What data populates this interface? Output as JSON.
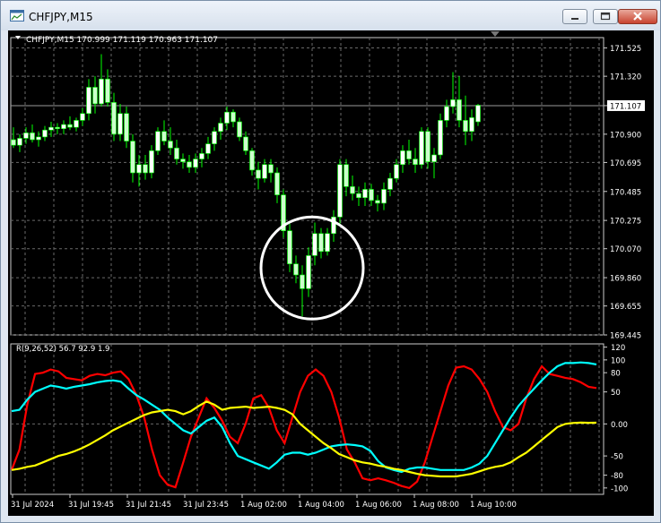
{
  "window": {
    "title": "CHFJPY,M15",
    "icons": {
      "app": "chart-window-icon",
      "minimize": "minimize-icon",
      "maximize": "maximize-icon",
      "close": "close-icon"
    }
  },
  "chart_data": [
    {
      "type": "candlestick",
      "title": "CHFJPY,M15",
      "ohlc_header": "CHFJPY,M15  170.999 171.119 170.963 171.107",
      "ylim": [
        169.445,
        171.6
      ],
      "yticks": [
        "171.525",
        "171.320",
        "171.107",
        "170.900",
        "170.695",
        "170.485",
        "170.275",
        "170.070",
        "169.860",
        "169.655",
        "169.445"
      ],
      "current_price": "171.107",
      "xticks": [
        "31 Jul 2024",
        "31 Jul 19:45",
        "31 Jul 21:45",
        "31 Jul 23:45",
        "1 Aug 02:00",
        "1 Aug 04:00",
        "1 Aug 06:00",
        "1 Aug 08:00",
        "1 Aug 10:00"
      ],
      "grid": true,
      "colors": {
        "background": "#000000",
        "up_candle": "#ffffff",
        "down_candle": "#ccffcc",
        "wick": "#00ff00",
        "grid": "#6a6a6a",
        "text": "#ffffff",
        "annotation": "#ffffff"
      },
      "annotations": [
        {
          "shape": "circle",
          "center_price": 169.93
        }
      ],
      "candles": [
        [
          170.86,
          170.95,
          170.8,
          170.82
        ],
        [
          170.82,
          170.9,
          170.77,
          170.87
        ],
        [
          170.87,
          170.95,
          170.83,
          170.91
        ],
        [
          170.91,
          170.97,
          170.84,
          170.86
        ],
        [
          170.86,
          170.92,
          170.81,
          170.88
        ],
        [
          170.88,
          170.96,
          170.85,
          170.93
        ],
        [
          170.93,
          170.99,
          170.88,
          170.95
        ],
        [
          170.95,
          170.98,
          170.9,
          170.94
        ],
        [
          170.94,
          171.0,
          170.9,
          170.97
        ],
        [
          170.97,
          171.03,
          170.93,
          170.95
        ],
        [
          170.95,
          171.02,
          170.92,
          171.0
        ],
        [
          171.0,
          171.09,
          170.96,
          171.05
        ],
        [
          171.05,
          171.3,
          171.0,
          171.24
        ],
        [
          171.24,
          171.32,
          171.05,
          171.12
        ],
        [
          171.12,
          171.48,
          171.1,
          171.3
        ],
        [
          171.3,
          171.37,
          171.1,
          171.13
        ],
        [
          171.13,
          171.2,
          170.85,
          170.9
        ],
        [
          170.9,
          171.12,
          170.85,
          171.05
        ],
        [
          171.05,
          171.1,
          170.8,
          170.85
        ],
        [
          170.85,
          170.9,
          170.55,
          170.62
        ],
        [
          170.62,
          170.75,
          170.52,
          170.68
        ],
        [
          170.68,
          170.75,
          170.57,
          170.62
        ],
        [
          170.62,
          170.82,
          170.58,
          170.78
        ],
        [
          170.78,
          170.95,
          170.75,
          170.92
        ],
        [
          170.92,
          171.0,
          170.82,
          170.85
        ],
        [
          170.85,
          170.95,
          170.75,
          170.8
        ],
        [
          170.8,
          170.86,
          170.68,
          170.72
        ],
        [
          170.72,
          170.76,
          170.65,
          170.7
        ],
        [
          170.7,
          170.75,
          170.62,
          170.66
        ],
        [
          170.66,
          170.76,
          170.62,
          170.72
        ],
        [
          170.72,
          170.8,
          170.66,
          170.76
        ],
        [
          170.76,
          170.88,
          170.72,
          170.83
        ],
        [
          170.83,
          170.95,
          170.78,
          170.92
        ],
        [
          170.92,
          171.02,
          170.86,
          170.98
        ],
        [
          170.98,
          171.1,
          170.93,
          171.06
        ],
        [
          171.06,
          171.08,
          170.95,
          170.99
        ],
        [
          170.99,
          171.02,
          170.85,
          170.88
        ],
        [
          170.88,
          170.92,
          170.75,
          170.78
        ],
        [
          170.78,
          170.8,
          170.6,
          170.64
        ],
        [
          170.64,
          170.7,
          170.5,
          170.58
        ],
        [
          170.58,
          170.72,
          170.55,
          170.68
        ],
        [
          170.68,
          170.72,
          170.55,
          170.62
        ],
        [
          170.62,
          170.66,
          170.4,
          170.46
        ],
        [
          170.46,
          170.5,
          170.15,
          170.2
        ],
        [
          170.2,
          170.25,
          169.9,
          169.96
        ],
        [
          169.96,
          170.02,
          169.82,
          169.88
        ],
        [
          169.88,
          169.95,
          169.58,
          169.78
        ],
        [
          169.78,
          170.08,
          169.72,
          170.02
        ],
        [
          170.02,
          170.26,
          169.95,
          170.18
        ],
        [
          170.18,
          170.22,
          170.0,
          170.05
        ],
        [
          170.05,
          170.22,
          170.02,
          170.18
        ],
        [
          170.18,
          170.35,
          170.12,
          170.3
        ],
        [
          170.3,
          170.72,
          170.25,
          170.68
        ],
        [
          170.68,
          170.72,
          170.45,
          170.52
        ],
        [
          170.52,
          170.6,
          170.42,
          170.47
        ],
        [
          170.47,
          170.52,
          170.38,
          170.44
        ],
        [
          170.44,
          170.55,
          170.38,
          170.5
        ],
        [
          170.5,
          170.54,
          170.38,
          170.42
        ],
        [
          170.42,
          170.46,
          170.34,
          170.4
        ],
        [
          170.4,
          170.55,
          170.35,
          170.5
        ],
        [
          170.5,
          170.62,
          170.45,
          170.58
        ],
        [
          170.58,
          170.72,
          170.55,
          170.68
        ],
        [
          170.68,
          170.82,
          170.62,
          170.78
        ],
        [
          170.78,
          170.86,
          170.68,
          170.72
        ],
        [
          170.72,
          170.8,
          170.62,
          170.68
        ],
        [
          170.68,
          170.95,
          170.65,
          170.92
        ],
        [
          170.92,
          170.95,
          170.65,
          170.7
        ],
        [
          170.7,
          170.8,
          170.58,
          170.75
        ],
        [
          170.75,
          171.05,
          170.72,
          171.0
        ],
        [
          171.0,
          171.15,
          170.95,
          171.1
        ],
        [
          171.1,
          171.35,
          171.05,
          171.15
        ],
        [
          171.15,
          171.32,
          170.95,
          171.0
        ],
        [
          171.0,
          171.18,
          170.82,
          170.92
        ],
        [
          170.92,
          171.08,
          170.85,
          171.02
        ],
        [
          170.99,
          171.12,
          170.96,
          171.11
        ]
      ]
    },
    {
      "type": "line",
      "label": "R(9,26,52) 56.7 92.9 1.9",
      "ylim": [
        -110,
        125
      ],
      "yticks": [
        "120",
        "100",
        "80",
        "50",
        "0.00",
        "-50",
        "-80",
        "-100"
      ],
      "series": [
        {
          "color": "#ff0000",
          "values": [
            -72,
            -40,
            30,
            78,
            80,
            85,
            82,
            72,
            70,
            68,
            75,
            78,
            76,
            80,
            82,
            70,
            45,
            10,
            -40,
            -80,
            -95,
            -99,
            -60,
            -20,
            10,
            40,
            25,
            5,
            -20,
            -30,
            0,
            40,
            45,
            25,
            -10,
            -30,
            10,
            50,
            75,
            85,
            75,
            50,
            10,
            -40,
            -60,
            -85,
            -88,
            -85,
            -88,
            -92,
            -97,
            -100,
            -90,
            -60,
            -20,
            20,
            60,
            88,
            90,
            85,
            70,
            50,
            20,
            -5,
            -10,
            0,
            40,
            70,
            90,
            78,
            75,
            72,
            70,
            65,
            58,
            56
          ]
        },
        {
          "color": "#00ffff",
          "values": [
            20,
            22,
            38,
            50,
            55,
            60,
            58,
            55,
            58,
            60,
            62,
            65,
            67,
            68,
            66,
            55,
            45,
            38,
            30,
            22,
            10,
            0,
            -10,
            -15,
            -5,
            5,
            10,
            -5,
            -30,
            -50,
            -55,
            -60,
            -65,
            -70,
            -60,
            -48,
            -45,
            -45,
            -48,
            -45,
            -40,
            -35,
            -33,
            -32,
            -33,
            -35,
            -42,
            -58,
            -68,
            -72,
            -75,
            -70,
            -68,
            -68,
            -70,
            -72,
            -72,
            -72,
            -72,
            -68,
            -62,
            -50,
            -30,
            -10,
            10,
            28,
            42,
            55,
            68,
            80,
            90,
            95,
            95,
            96,
            95,
            93
          ]
        },
        {
          "color": "#ffff00",
          "values": [
            -72,
            -70,
            -67,
            -65,
            -60,
            -55,
            -50,
            -47,
            -43,
            -38,
            -32,
            -25,
            -18,
            -10,
            -4,
            2,
            8,
            14,
            18,
            20,
            22,
            20,
            15,
            20,
            28,
            35,
            30,
            22,
            25,
            26,
            27,
            25,
            26,
            27,
            25,
            22,
            15,
            0,
            -10,
            -20,
            -30,
            -38,
            -47,
            -52,
            -57,
            -60,
            -62,
            -65,
            -67,
            -70,
            -72,
            -75,
            -78,
            -80,
            -81,
            -82,
            -82,
            -82,
            -80,
            -78,
            -74,
            -70,
            -67,
            -65,
            -60,
            -52,
            -45,
            -35,
            -25,
            -15,
            -5,
            0,
            1.5,
            2,
            1.8,
            1.9
          ]
        }
      ]
    }
  ]
}
